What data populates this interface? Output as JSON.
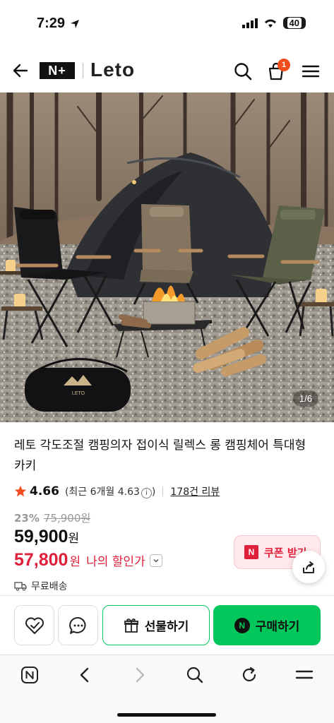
{
  "status": {
    "time": "7:29",
    "battery": "40"
  },
  "header": {
    "nplus": "N+",
    "brand": "Leto",
    "cart_count": "1"
  },
  "hero": {
    "counter": "1/6",
    "product_print": "LETO",
    "bag_print": "LETO"
  },
  "product": {
    "title": "레토 각도조절 캠핑의자 접이식 릴렉스 롱 캠핑체어 특대형 카키",
    "rating": "4.66",
    "recent_rating": "(최근 6개월 4.63",
    "recent_close": ")",
    "review_count": "178건 리뷰",
    "discount_rate": "23%",
    "original_price": "75,900원",
    "price": "59,900",
    "price_unit": "원",
    "my_price": "57,800",
    "my_price_unit": "원",
    "my_price_label": "나의 할인가",
    "coupon_label": "쿠폰 받기",
    "shipping": "무료배송"
  },
  "actions": {
    "gift": "선물하기",
    "buy": "구매하기"
  },
  "colors": {
    "naver_green": "#03c75a",
    "sale_red": "#e0203a",
    "badge_orange": "#f24d1d"
  }
}
